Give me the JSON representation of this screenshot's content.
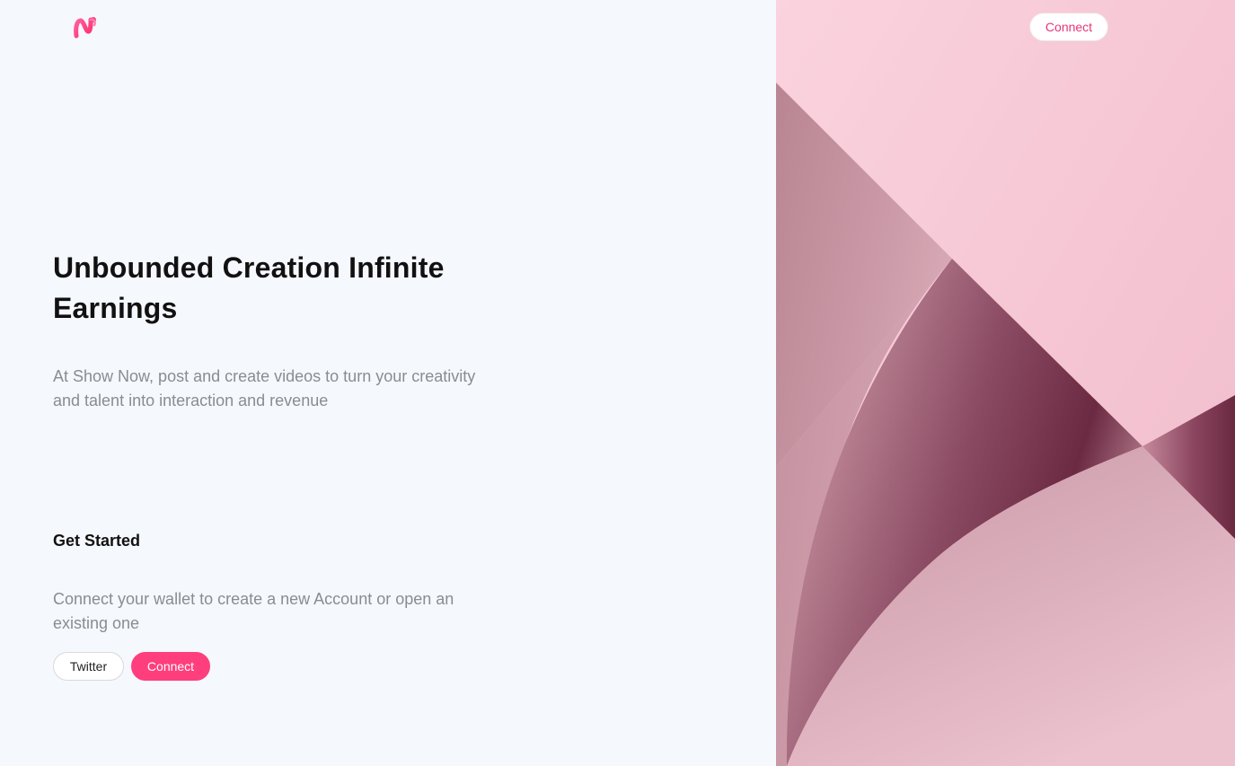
{
  "header": {
    "connect_label": "Connect"
  },
  "hero": {
    "headline": "Unbounded Creation Infinite Earnings",
    "description": "At Show Now, post and create videos to turn your creativity and talent into interaction and revenue"
  },
  "get_started": {
    "title": "Get Started",
    "description": "Connect your wallet to create a new Account or open an existing one",
    "twitter_label": "Twitter",
    "connect_label": "Connect"
  },
  "colors": {
    "accent": "#ff3e7d",
    "background": "#f5f8fc",
    "art_pink": "#f4c8d5",
    "art_dark": "#6b2a42"
  },
  "icons": {
    "logo": "show-now-logo"
  }
}
